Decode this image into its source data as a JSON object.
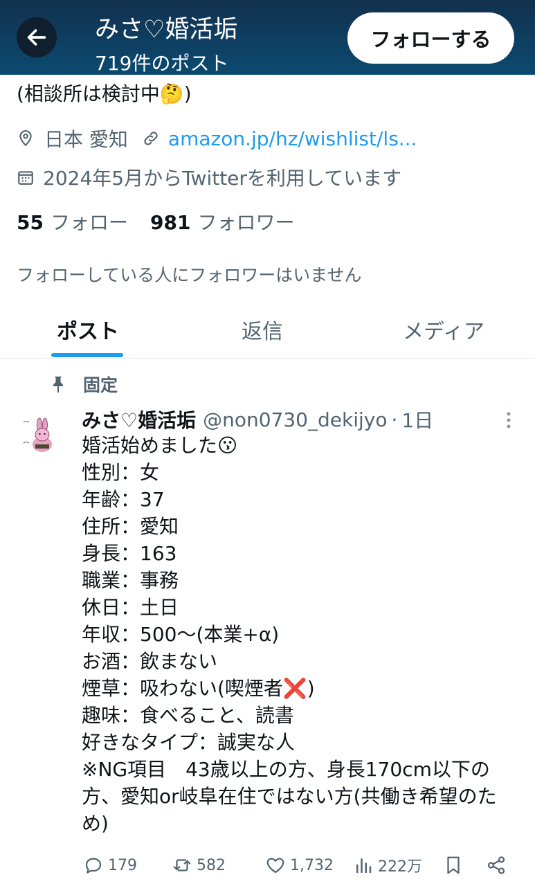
{
  "header": {
    "title": "みさ♡婚活垢",
    "post_count": "719件のポスト",
    "follow_button": "フォローする"
  },
  "profile": {
    "bio_tail": "(相談所は検討中🤔)",
    "location": "日本 愛知",
    "link": "amazon.jp/hz/wishlist/ls...",
    "joined": "2024年5月からTwitterを利用しています",
    "following_count": "55",
    "following_label": "フォロー",
    "followers_count": "981",
    "followers_label": "フォロワー",
    "no_mutuals": "フォローしている人にフォロワーはいません"
  },
  "tabs": [
    {
      "label": "ポスト",
      "active": true
    },
    {
      "label": "返信",
      "active": false
    },
    {
      "label": "メディア",
      "active": false
    }
  ],
  "tweet": {
    "pinned_label": "固定",
    "name": "みさ♡婚活垢",
    "handle": "@non0730_dekijyo",
    "dot": "·",
    "time": "1日",
    "lines": [
      "婚活始めました😗",
      "性別：女",
      "年齢：37",
      "住所：愛知",
      "身長：163",
      "職業：事務",
      "休日：土日",
      "年収：500〜(本業+α)",
      "お酒：飲まない",
      "煙草：吸わない(喫煙者❌)",
      "趣味：食べること、読書",
      "好きなタイプ：誠実な人"
    ],
    "ng_text": "※NG項目　43歳以上の方、身長170cm以下の方、愛知or岐阜在住ではない方(共働き希望のため)",
    "stats": {
      "replies": "179",
      "retweets": "582",
      "likes": "1,732",
      "views": "222万"
    }
  },
  "colors": {
    "header_top": "#12314f",
    "header_bottom": "#0b4a70",
    "accent": "#1d9bf0",
    "secondary_text": "#536471"
  },
  "icons": {
    "back": "arrow-left-icon",
    "location": "location-pin-icon",
    "link": "link-icon",
    "calendar": "calendar-icon",
    "pin": "pushpin-icon",
    "more": "more-vertical-icon",
    "reply": "reply-icon",
    "retweet": "retweet-icon",
    "like": "heart-icon",
    "views": "views-chart-icon",
    "bookmark": "bookmark-icon",
    "share": "share-icon"
  }
}
